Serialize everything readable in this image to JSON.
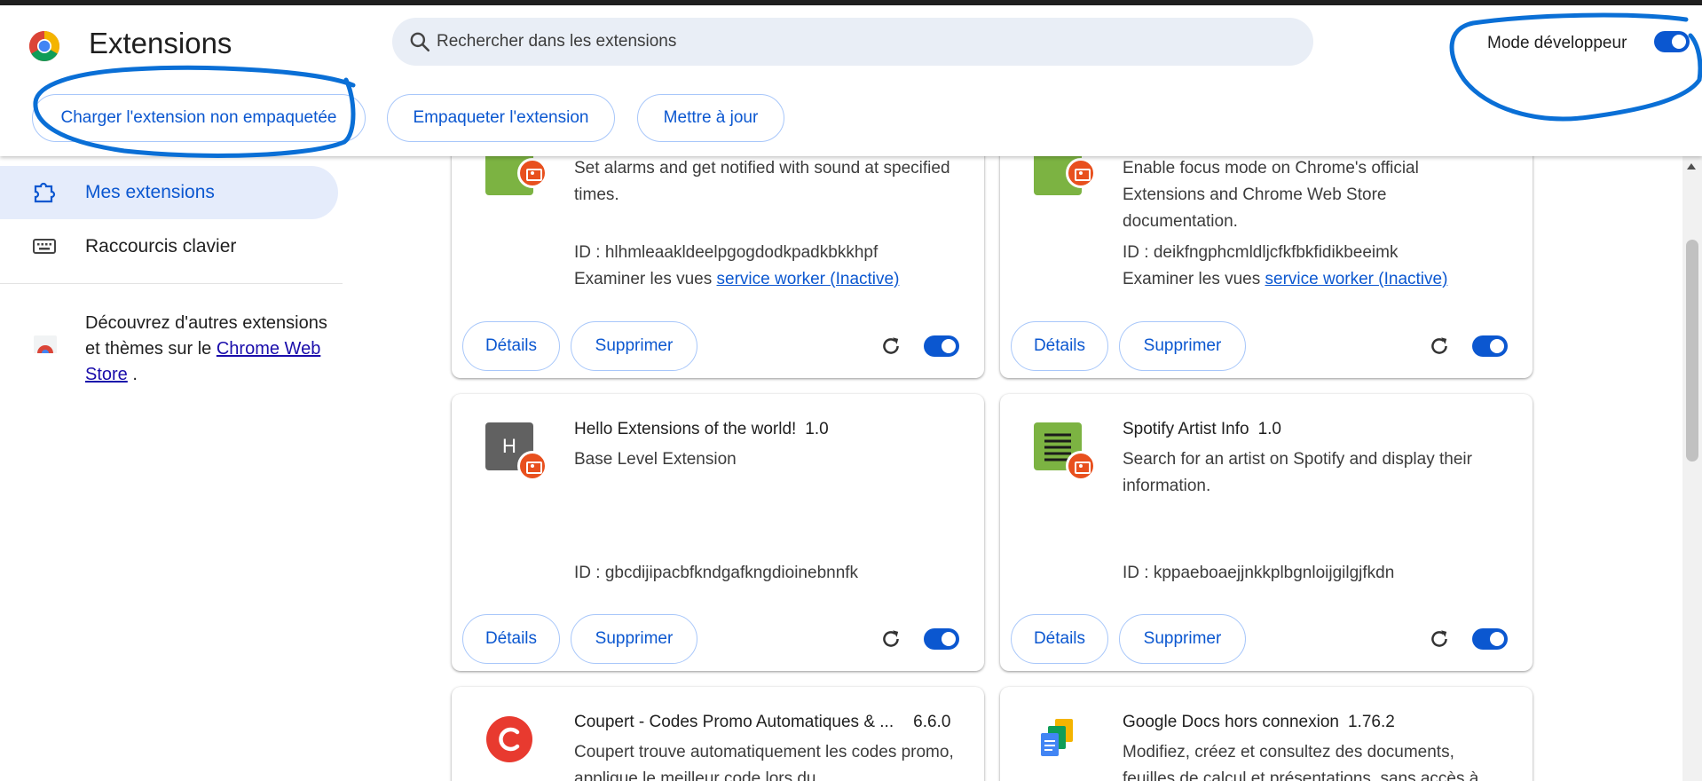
{
  "header": {
    "title": "Extensions",
    "search_placeholder": "Rechercher dans les extensions",
    "dev_mode_label": "Mode développeur",
    "dev_mode_on": true,
    "load_unpacked": "Charger l'extension non empaquetée",
    "pack_extension": "Empaqueter l'extension",
    "update": "Mettre à jour"
  },
  "sidebar": {
    "items": [
      {
        "label": "Mes extensions",
        "icon": "puzzle-icon",
        "active": true
      },
      {
        "label": "Raccourcis clavier",
        "icon": "keyboard-icon",
        "active": false
      }
    ],
    "store_text": "Découvrez d'autres extensions et thèmes sur le",
    "store_link": "Chrome Web Store",
    "store_suffix": "."
  },
  "card_labels": {
    "details": "Détails",
    "remove": "Supprimer",
    "inspect_views": "Examiner les vues",
    "service_worker": "service worker (Inactive)"
  },
  "extensions": [
    {
      "name": "",
      "version": "",
      "description": "Set alarms and get notified with sound at specified times.",
      "id": "ID : hlhmleaakldeelpgogdodkpadkbkkhpf",
      "enabled": true,
      "icon": "green-list-icon"
    },
    {
      "name": "",
      "version": "",
      "description": "Enable focus mode on Chrome's official Extensions and Chrome Web Store documentation.",
      "id": "ID : deikfngphcmldljcfkfbkfidikbeeimk",
      "enabled": true,
      "icon": "green-list-icon"
    },
    {
      "name": "Hello Extensions of the world!",
      "version": "1.0",
      "description": "Base Level Extension",
      "id": "ID : gbcdijipacbfkndgafkngdioinebnnfk",
      "enabled": true,
      "icon": "letter-h-icon",
      "icon_letter": "H"
    },
    {
      "name": "Spotify Artist Info",
      "version": "1.0",
      "description": "Search for an artist on Spotify and display their information.",
      "id": "ID : kppaeboaejjnkkplbgnloijgilgjfkdn",
      "enabled": true,
      "icon": "green-list-icon"
    },
    {
      "name": "Coupert - Codes Promo Automatiques & ...",
      "version": "6.6.0",
      "description": "Coupert trouve automatiquement les codes promo, applique le meilleur code lors du",
      "icon": "coupert-logo-icon"
    },
    {
      "name": "Google Docs hors connexion",
      "version": "1.76.2",
      "description": "Modifiez, créez et consultez des documents, feuilles de calcul et présentations, sans accès à",
      "icon": "google-docs-icon"
    }
  ],
  "colors": {
    "accent": "#0b57d0",
    "active_nav_bg": "#e5ecfb",
    "annotation": "#0a6fd6",
    "badge": "#e8501e"
  }
}
